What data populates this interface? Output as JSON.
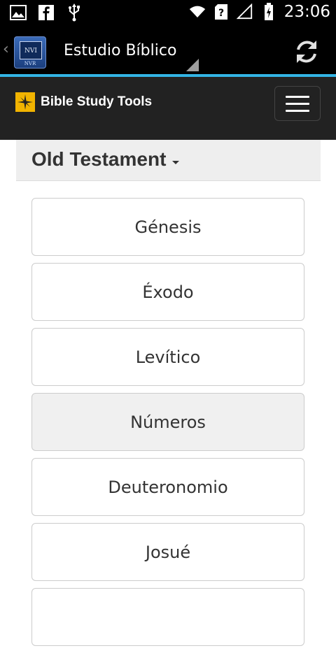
{
  "status_bar": {
    "time": "23:06",
    "icons": [
      "image-icon",
      "facebook-icon",
      "usb-icon",
      "wifi-icon",
      "sim-unknown-icon",
      "signal-icon",
      "battery-charging-icon"
    ]
  },
  "action_bar": {
    "title": "Estudio Bíblico",
    "app_icon_text": [
      "NVI",
      "NVR"
    ],
    "accent_color": "#33b5e5"
  },
  "site_header": {
    "logo_text": "Bible Study Tools",
    "logo_color": "#f2b400"
  },
  "section": {
    "title": "Old Testament"
  },
  "books": [
    {
      "label": "Génesis"
    },
    {
      "label": "Éxodo"
    },
    {
      "label": "Levítico"
    },
    {
      "label": "Números"
    },
    {
      "label": "Deuteronomio"
    },
    {
      "label": "Josué"
    }
  ]
}
